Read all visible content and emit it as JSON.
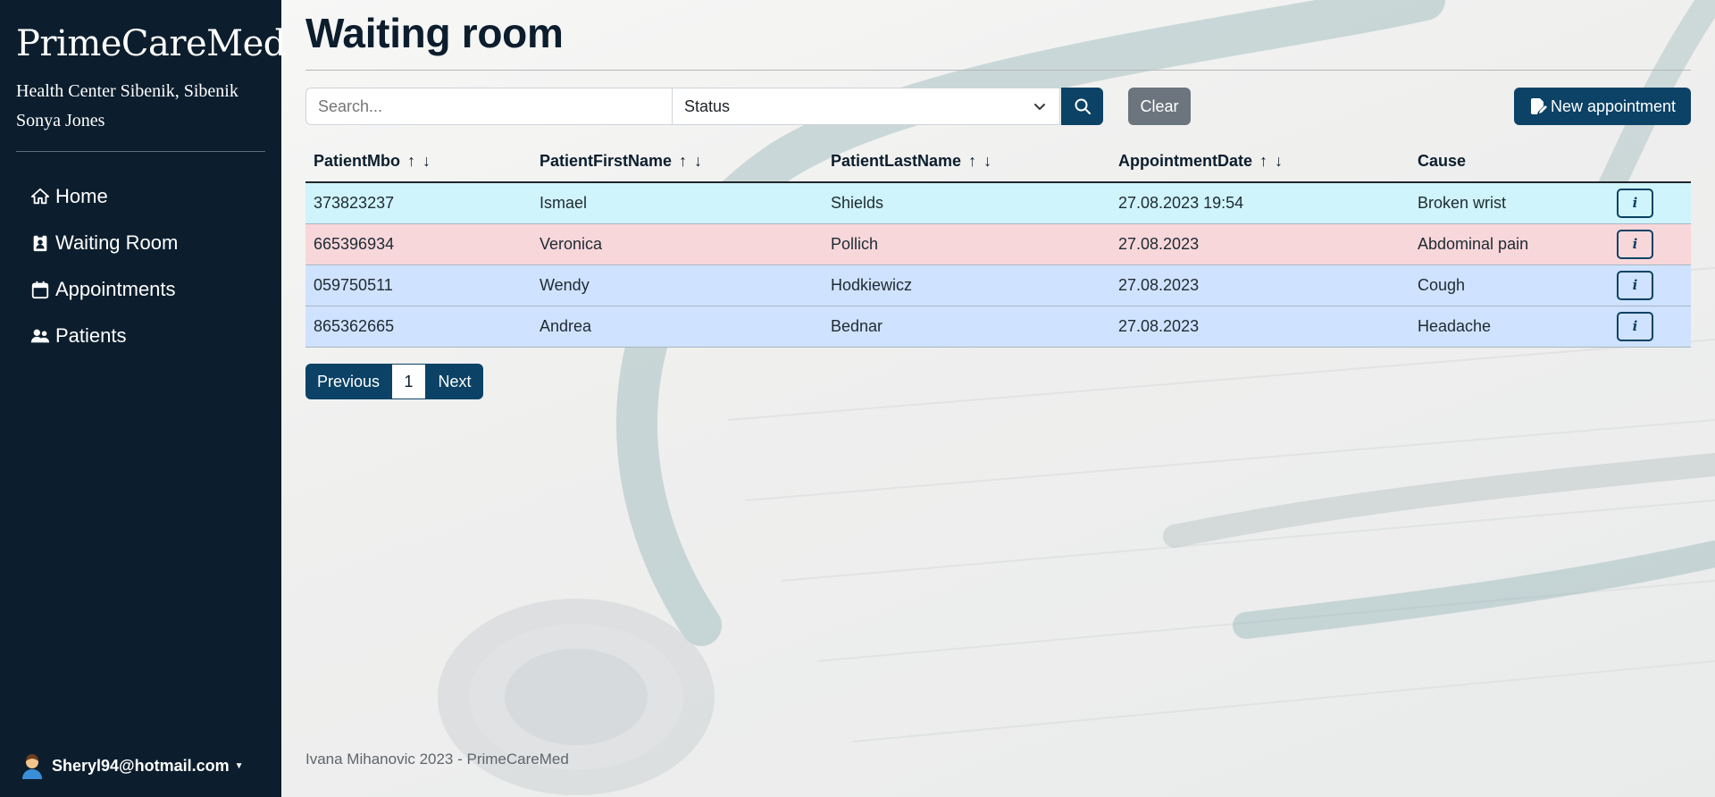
{
  "sidebar": {
    "brand": "PrimeCareMed",
    "health_center": "Health Center Sibenik, Sibenik",
    "user_name": "Sonya Jones",
    "nav": [
      {
        "label": "Home",
        "icon": "home-icon"
      },
      {
        "label": "Waiting Room",
        "icon": "id-badge-icon"
      },
      {
        "label": "Appointments",
        "icon": "calendar-icon"
      },
      {
        "label": "Patients",
        "icon": "users-icon"
      }
    ],
    "account_email": "Sheryl94@hotmail.com"
  },
  "main": {
    "title": "Waiting room",
    "search_placeholder": "Search...",
    "status_select": "Status",
    "clear_label": "Clear",
    "new_appointment_label": "New appointment"
  },
  "table": {
    "headers": [
      "PatientMbo",
      "PatientFirstName",
      "PatientLastName",
      "AppointmentDate",
      "Cause"
    ],
    "sort_up": "↑",
    "sort_down": "↓",
    "info_label": "i",
    "rows": [
      {
        "mbo": "373823237",
        "first": "Ismael",
        "last": "Shields",
        "date": "27.08.2023 19:54",
        "cause": "Broken wrist",
        "status_color": "#cff4fc"
      },
      {
        "mbo": "665396934",
        "first": "Veronica",
        "last": "Pollich",
        "date": "27.08.2023",
        "cause": "Abdominal pain",
        "status_color": "#f8d7da"
      },
      {
        "mbo": "059750511",
        "first": "Wendy",
        "last": "Hodkiewicz",
        "date": "27.08.2023",
        "cause": "Cough",
        "status_color": "#cfe2ff"
      },
      {
        "mbo": "865362665",
        "first": "Andrea",
        "last": "Bednar",
        "date": "27.08.2023",
        "cause": "Headache",
        "status_color": "#cfe2ff"
      }
    ]
  },
  "pagination": {
    "previous": "Previous",
    "page": "1",
    "next": "Next"
  },
  "footer": "Ivana Mihanovic 2023 - PrimeCareMed",
  "colors": {
    "sidebar_bg": "#0c1e2e",
    "primary": "#0b4266",
    "secondary": "#6c757d"
  }
}
